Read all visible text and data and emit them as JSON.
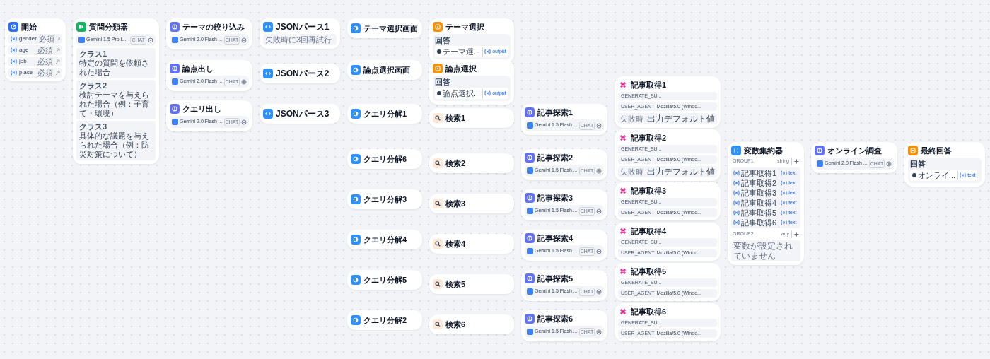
{
  "nodes": [
    {
      "kind": "start",
      "title": "開始",
      "variables": [
        {
          "name": "gender",
          "required": "必須"
        },
        {
          "name": "age",
          "required": "必須"
        },
        {
          "name": "job",
          "required": "必須"
        },
        {
          "name": "place",
          "required": "必須"
        }
      ]
    },
    {
      "kind": "classifier",
      "title": "質問分類器",
      "model": "Gemini 1.5 Pro L...",
      "mode": "CHAT",
      "classes": [
        {
          "label": "クラス1",
          "text": "特定の質問を依頼された場合"
        },
        {
          "label": "クラス2",
          "text": "検討テーマを与えられた場合（例：子育て・環境）"
        },
        {
          "label": "クラス3",
          "text": "具体的な議題を与えられた場合（例：防災対策について）"
        }
      ]
    },
    {
      "kind": "llm",
      "title": "テーマの絞り込み",
      "model": "Gemini 2.0 Flash ...",
      "mode": "CHAT"
    },
    {
      "kind": "code",
      "title": "JSONパース1",
      "note": "失敗時に3回再試行"
    },
    {
      "kind": "answer",
      "title": "テーマ選択画面"
    },
    {
      "kind": "question",
      "title": "テーマ選択",
      "label": "回答",
      "value": "テーマ選...",
      "variable": "output"
    },
    {
      "kind": "llm",
      "title": "論点出し",
      "model": "Gemini 2.0 Flash ...",
      "mode": "CHAT"
    },
    {
      "kind": "code",
      "title": "JSONパース2"
    },
    {
      "kind": "answer",
      "title": "論点選択画面"
    },
    {
      "kind": "question",
      "title": "論点選択",
      "label": "回答",
      "value": "論点選択...",
      "variable": "output"
    },
    {
      "kind": "llm",
      "title": "クエリ出し",
      "model": "Gemini 2.0 Flash ...",
      "mode": "CHAT"
    },
    {
      "kind": "code",
      "title": "JSONパース3"
    },
    {
      "kind": "answer",
      "title": "クエリ分解1"
    },
    {
      "kind": "tool",
      "title": "検索1"
    },
    {
      "kind": "llm",
      "title": "記事探索1",
      "model": "Gemini 1.5 Flash ...",
      "mode": "CHAT"
    },
    {
      "kind": "http",
      "title": "記事取得1",
      "params": [
        "GENERATE_SU..."
      ],
      "headers": [
        {
          "key": "USER_AGENT",
          "value": "Mozilla/5.0 (Windo..."
        }
      ],
      "on_error": {
        "label": "失敗時",
        "value": "出力デフォルト値"
      }
    },
    {
      "kind": "answer",
      "title": "クエリ分解6"
    },
    {
      "kind": "tool",
      "title": "検索2"
    },
    {
      "kind": "llm",
      "title": "記事探索2",
      "model": "Gemini 1.5 Flash ...",
      "mode": "CHAT"
    },
    {
      "kind": "http",
      "title": "記事取得2",
      "params": [
        "GENERATE_SU..."
      ],
      "headers": [
        {
          "key": "USER_AGENT",
          "value": "Mozilla/5.0 (Windo..."
        }
      ],
      "on_error": {
        "label": "失敗時",
        "value": "出力デフォルト値"
      }
    },
    {
      "kind": "answer",
      "title": "クエリ分解3"
    },
    {
      "kind": "tool",
      "title": "検索3"
    },
    {
      "kind": "llm",
      "title": "記事探索3",
      "model": "Gemini 1.5 Flash ...",
      "mode": "CHAT"
    },
    {
      "kind": "http",
      "title": "記事取得3",
      "params": [
        "GENERATE_SU..."
      ],
      "headers": [
        {
          "key": "USER_AGENT",
          "value": "Mozilla/5.0 (Windo..."
        }
      ]
    },
    {
      "kind": "answer",
      "title": "クエリ分解4"
    },
    {
      "kind": "tool",
      "title": "検索4"
    },
    {
      "kind": "llm",
      "title": "記事探索4",
      "model": "Gemini 1.5 Flash ...",
      "mode": "CHAT"
    },
    {
      "kind": "http",
      "title": "記事取得4",
      "params": [
        "GENERATE_SU..."
      ],
      "headers": [
        {
          "key": "USER_AGENT",
          "value": "Mozilla/5.0 (Windo..."
        }
      ]
    },
    {
      "kind": "answer",
      "title": "クエリ分解5"
    },
    {
      "kind": "tool",
      "title": "検索5"
    },
    {
      "kind": "llm",
      "title": "記事探索5",
      "model": "Gemini 1.5 Flash ...",
      "mode": "CHAT"
    },
    {
      "kind": "http",
      "title": "記事取得5",
      "params": [
        "GENERATE_SU..."
      ],
      "headers": [
        {
          "key": "USER_AGENT",
          "value": "Mozilla/5.0 (Windo..."
        }
      ]
    },
    {
      "kind": "answer",
      "title": "クエリ分解2"
    },
    {
      "kind": "tool",
      "title": "検索6"
    },
    {
      "kind": "llm",
      "title": "記事探索6",
      "model": "Gemini 1.5 Flash ...",
      "mode": "CHAT"
    },
    {
      "kind": "http",
      "title": "記事取得6",
      "params": [
        "GENERATE_SU..."
      ],
      "headers": [
        {
          "key": "USER_AGENT",
          "value": "Mozilla/5.0 (Windo..."
        }
      ]
    },
    {
      "kind": "aggregator",
      "title": "変数集約器",
      "groups": [
        {
          "name": "GROUP1",
          "type": "string",
          "variables": [
            {
              "node": "記事取得1",
              "variable": "text"
            },
            {
              "node": "記事取得2",
              "variable": "text"
            },
            {
              "node": "記事取得3",
              "variable": "text"
            },
            {
              "node": "記事取得4",
              "variable": "text"
            },
            {
              "node": "記事取得5",
              "variable": "text"
            },
            {
              "node": "記事取得6",
              "variable": "text"
            }
          ]
        },
        {
          "name": "GROUP2",
          "type": "any",
          "empty": "変数が設定されていません"
        }
      ]
    },
    {
      "kind": "llm",
      "title": "オンライン調査",
      "model": "Gemini 2.0 Flash ...",
      "mode": "CHAT"
    },
    {
      "kind": "end",
      "title": "最終回答",
      "label": "回答",
      "value": "オンライ...",
      "variable": "text"
    }
  ]
}
